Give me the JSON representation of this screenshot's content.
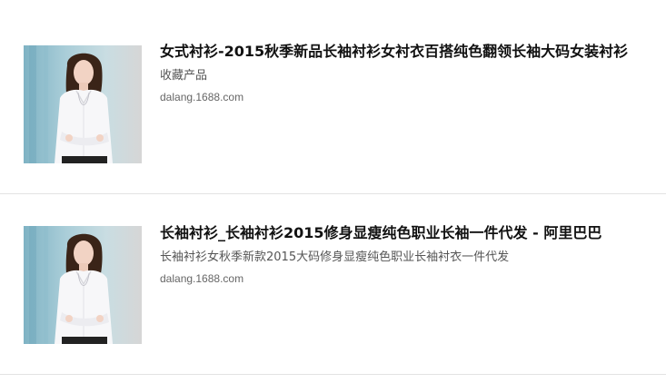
{
  "results": [
    {
      "title": "女式衬衫-2015秋季新品长袖衬衫女衬衣百搭纯色翻领长袖大码女装衬衫",
      "description": "收藏产品",
      "url": "dalang.1688.com",
      "thumbnail_icon": "product-photo-woman-white-shirt"
    },
    {
      "title": "长袖衬衫_长袖衬衫2015修身显瘦纯色职业长袖一件代发 - 阿里巴巴",
      "description": "长袖衬衫女秋季新款2015大码修身显瘦纯色职业长袖衬衣一件代发",
      "url": "dalang.1688.com",
      "thumbnail_icon": "product-photo-woman-white-shirt"
    }
  ],
  "colors": {
    "title": "#111111",
    "description": "#555555",
    "url": "#666666",
    "divider": "#e3e3e3",
    "thumb_background": "#9fc3cf"
  }
}
